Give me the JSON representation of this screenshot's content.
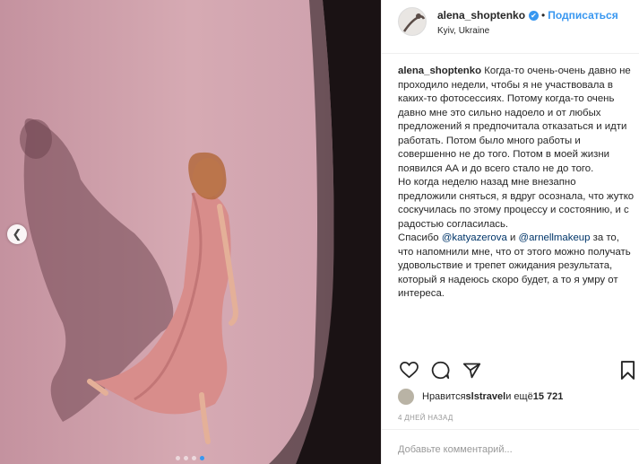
{
  "post": {
    "username": "alena_shoptenko",
    "verified_mark": "✔",
    "separator": "•",
    "follow_label": "Подписаться",
    "location": "Kyiv, Ukraine"
  },
  "caption": {
    "username": "alena_shoptenko",
    "text_part1": " Когда-то очень-очень давно не проходило недели, чтобы я не участвовала в каких-то фотосессиях. Потому когда-то очень давно мне это сильно надоело и от любых предложений я предпочитала отказаться и идти работать. Потом было много работы и совершенно не до того. Потом в моей жизни появился АА и до всего стало не до того.",
    "text_part2": "Но когда неделю назад мне внезапно предложили сняться, я вдруг осознала, что жутко соскучилась по этому процессу и состоянию, и с радостью согласилась.",
    "text_part3_pre": "Спасибо ",
    "mention1": "@katyazerova",
    "and_word": " и ",
    "mention2": "@arnellmakeup",
    "text_part3_post": " за то, что напомнили мне, что от этого можно получать удовольствие и трепет ожидания результата, который я надеюсь скоро будет, а то я умру от интереса."
  },
  "likes": {
    "prefix": "Нравится ",
    "user": "slstravel",
    "middle": " и ещё ",
    "count": "15 721"
  },
  "timestamp": "4 ДНЕЙ НАЗАД",
  "comment": {
    "placeholder": "Добавьте комментарий..."
  },
  "icons": {
    "like": "heart-icon",
    "comment": "comment-bubble-icon",
    "share": "share-icon",
    "save": "bookmark-icon",
    "prev": "chevron-left-icon"
  },
  "carousel": {
    "total": 4,
    "active_index": 3
  },
  "colors": {
    "accent": "#3897f0",
    "mention": "#003569",
    "muted": "#999999"
  }
}
